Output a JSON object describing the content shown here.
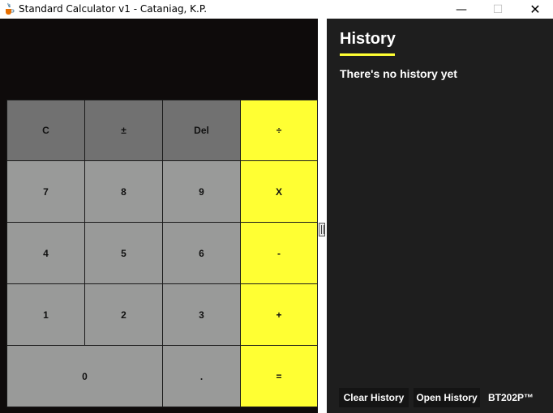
{
  "window": {
    "title": "Standard Calculator v1 - Cataniag, K.P.",
    "minimize_glyph": "—",
    "maximize_glyph": "☐",
    "close_glyph": "✕",
    "app_icon": "java-cup-icon"
  },
  "display": {
    "value": ""
  },
  "keypad": {
    "clear": "C",
    "negate": "±",
    "delete": "Del",
    "divide": "÷",
    "seven": "7",
    "eight": "8",
    "nine": "9",
    "multiply": "X",
    "four": "4",
    "five": "5",
    "six": "6",
    "subtract": "-",
    "one": "1",
    "two": "2",
    "three": "3",
    "add": "+",
    "zero": "0",
    "decimal": ".",
    "equals": "="
  },
  "history": {
    "title": "History",
    "empty_message": "There's no history yet",
    "clear_button": "Clear History",
    "open_button": "Open History",
    "brand_label": "BT202P™"
  },
  "colors": {
    "accent": "#ffff33",
    "function_key": "#717171",
    "number_key": "#999a99",
    "left_background": "#0e0b0b",
    "history_background": "#1e1e1e"
  }
}
